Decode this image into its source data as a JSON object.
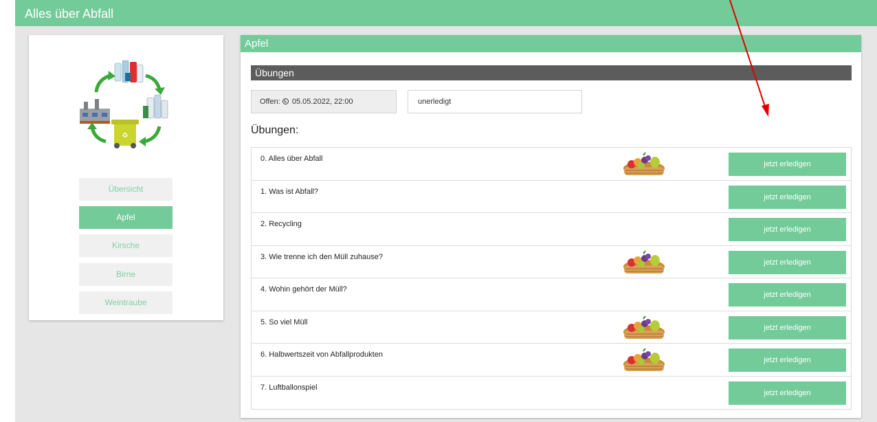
{
  "app": {
    "title": "Alles über Abfall"
  },
  "sidebar": {
    "items": [
      {
        "label": "Übersicht",
        "active": false
      },
      {
        "label": "Apfel",
        "active": true
      },
      {
        "label": "Kirsche",
        "active": false
      },
      {
        "label": "Birne",
        "active": false
      },
      {
        "label": "Weintraube",
        "active": false
      }
    ]
  },
  "main": {
    "header": "Apfel",
    "section_title": "Übungen",
    "offen_label": "Offen:",
    "offen_date": "05.05.2022, 22:00",
    "status": "unerledigt",
    "exercises_heading": "Übungen:",
    "exercises": [
      {
        "title": "0. Alles über Abfall",
        "has_basket": true,
        "button": "jetzt erledigen"
      },
      {
        "title": "1. Was ist Abfall?",
        "has_basket": false,
        "button": "jetzt erledigen"
      },
      {
        "title": "2. Recycling",
        "has_basket": false,
        "button": "jetzt erledigen"
      },
      {
        "title": "3. Wie trenne ich den Müll zuhause?",
        "has_basket": true,
        "button": "jetzt erledigen"
      },
      {
        "title": "4. Wohin gehört der Müll?",
        "has_basket": false,
        "button": "jetzt erledigen"
      },
      {
        "title": "5. So viel Müll",
        "has_basket": true,
        "button": "jetzt erledigen"
      },
      {
        "title": "6. Halbwertszeit von Abfallprodukten",
        "has_basket": true,
        "button": "jetzt erledigen"
      },
      {
        "title": "7. Luftballonspiel",
        "has_basket": false,
        "button": "jetzt erledigen"
      }
    ]
  },
  "colors": {
    "accent": "#72cb99",
    "section_bar": "#5c5c5c",
    "annotation_arrow": "#e00000"
  },
  "icons": [
    "recycling-logo-icon",
    "clock-icon",
    "fruit-basket-icon",
    "red-arrow-annotation"
  ]
}
